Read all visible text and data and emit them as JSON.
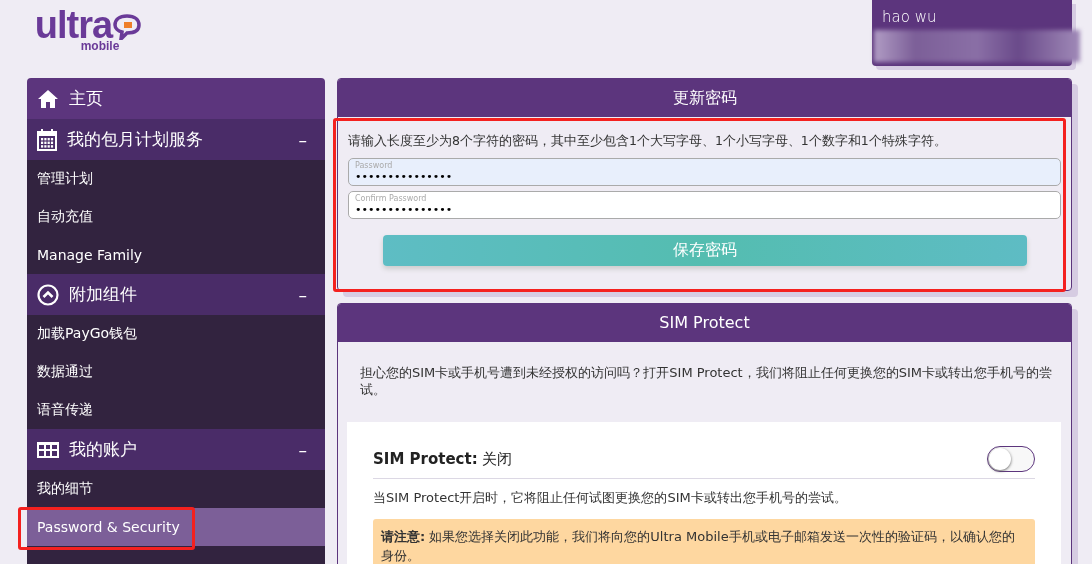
{
  "logo": {
    "wordmark": "ultra",
    "sub": "mobile"
  },
  "user": {
    "name": "hao wu"
  },
  "sidebar": {
    "items": [
      {
        "kind": "link",
        "label": "主页"
      },
      {
        "kind": "section",
        "label": "我的包月计划服务",
        "expanded": true,
        "toggle": "–",
        "children": [
          {
            "label": "管理计划",
            "selected": false
          },
          {
            "label": "自动充值",
            "selected": false
          },
          {
            "label": "Manage Family",
            "selected": false
          }
        ]
      },
      {
        "kind": "section",
        "label": "附加组件",
        "expanded": true,
        "toggle": "–",
        "children": [
          {
            "label": "加载PayGo钱包",
            "selected": false
          },
          {
            "label": "数据通过",
            "selected": false
          },
          {
            "label": "语音传递",
            "selected": false
          }
        ]
      },
      {
        "kind": "section",
        "label": "我的账户",
        "expanded": true,
        "toggle": "–",
        "children": [
          {
            "label": "我的细节",
            "selected": false
          },
          {
            "label": "Password & Security",
            "selected": true,
            "highlighted": true
          }
        ]
      }
    ]
  },
  "password_panel": {
    "title": "更新密码",
    "highlighted": true,
    "hint": "请输入长度至少为8个字符的密码，其中至少包含1个大写字母、1个小写字母、1个数字和1个特殊字符。",
    "fields": [
      {
        "label": "Password",
        "value": "•••••••••••••••",
        "autofilled": true
      },
      {
        "label": "Confirm Password",
        "value": "•••••••••••••••",
        "autofilled": false
      }
    ],
    "button": "保存密码"
  },
  "sim_panel": {
    "title": "SIM Protect",
    "intro": "担心您的SIM卡或手机号遭到未经授权的访问吗？打开SIM Protect，我们将阻止任何更换您的SIM卡或转出您手机号的尝试。",
    "card": {
      "heading": "SIM Protect:",
      "status": "关闭",
      "on": false,
      "description": "当SIM Protect开启时，它将阻止任何试图更换您的SIM卡或转出您手机号的尝试。",
      "note": "**请注意:** 如果您选择关闭此功能，我们将向您的Ultra Mobile手机或电子邮箱发送一次性的验证码，以确认您的身份。"
    }
  }
}
